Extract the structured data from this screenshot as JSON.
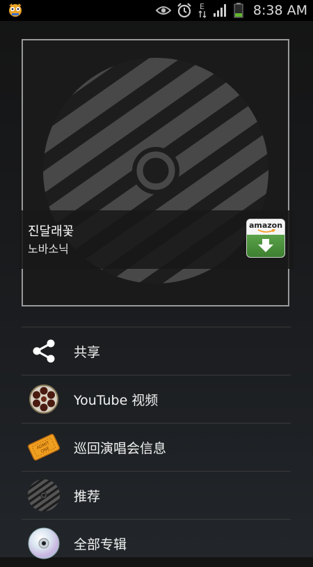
{
  "status_bar": {
    "time": "8:38 AM",
    "icons": [
      "app-mascot-icon",
      "eye-icon",
      "alarm-clock-icon",
      "data-e-icon",
      "signal-icon",
      "battery-icon"
    ]
  },
  "now_playing": {
    "song_title": "진달래꽃",
    "artist": "노바소닉",
    "amazon_label": "amazon"
  },
  "menu": {
    "items": [
      {
        "label": "共享",
        "icon": "share-icon"
      },
      {
        "label": "YouTube 视频",
        "icon": "film-reel-icon"
      },
      {
        "label": "巡回演唱会信息",
        "icon": "admit-one-ticket-icon"
      },
      {
        "label": "推荐",
        "icon": "striped-disc-icon"
      },
      {
        "label": "全部专辑",
        "icon": "cd-icon"
      }
    ]
  },
  "colors": {
    "amazon_green": "#4a9140",
    "frame_border": "#9a9a9a"
  }
}
